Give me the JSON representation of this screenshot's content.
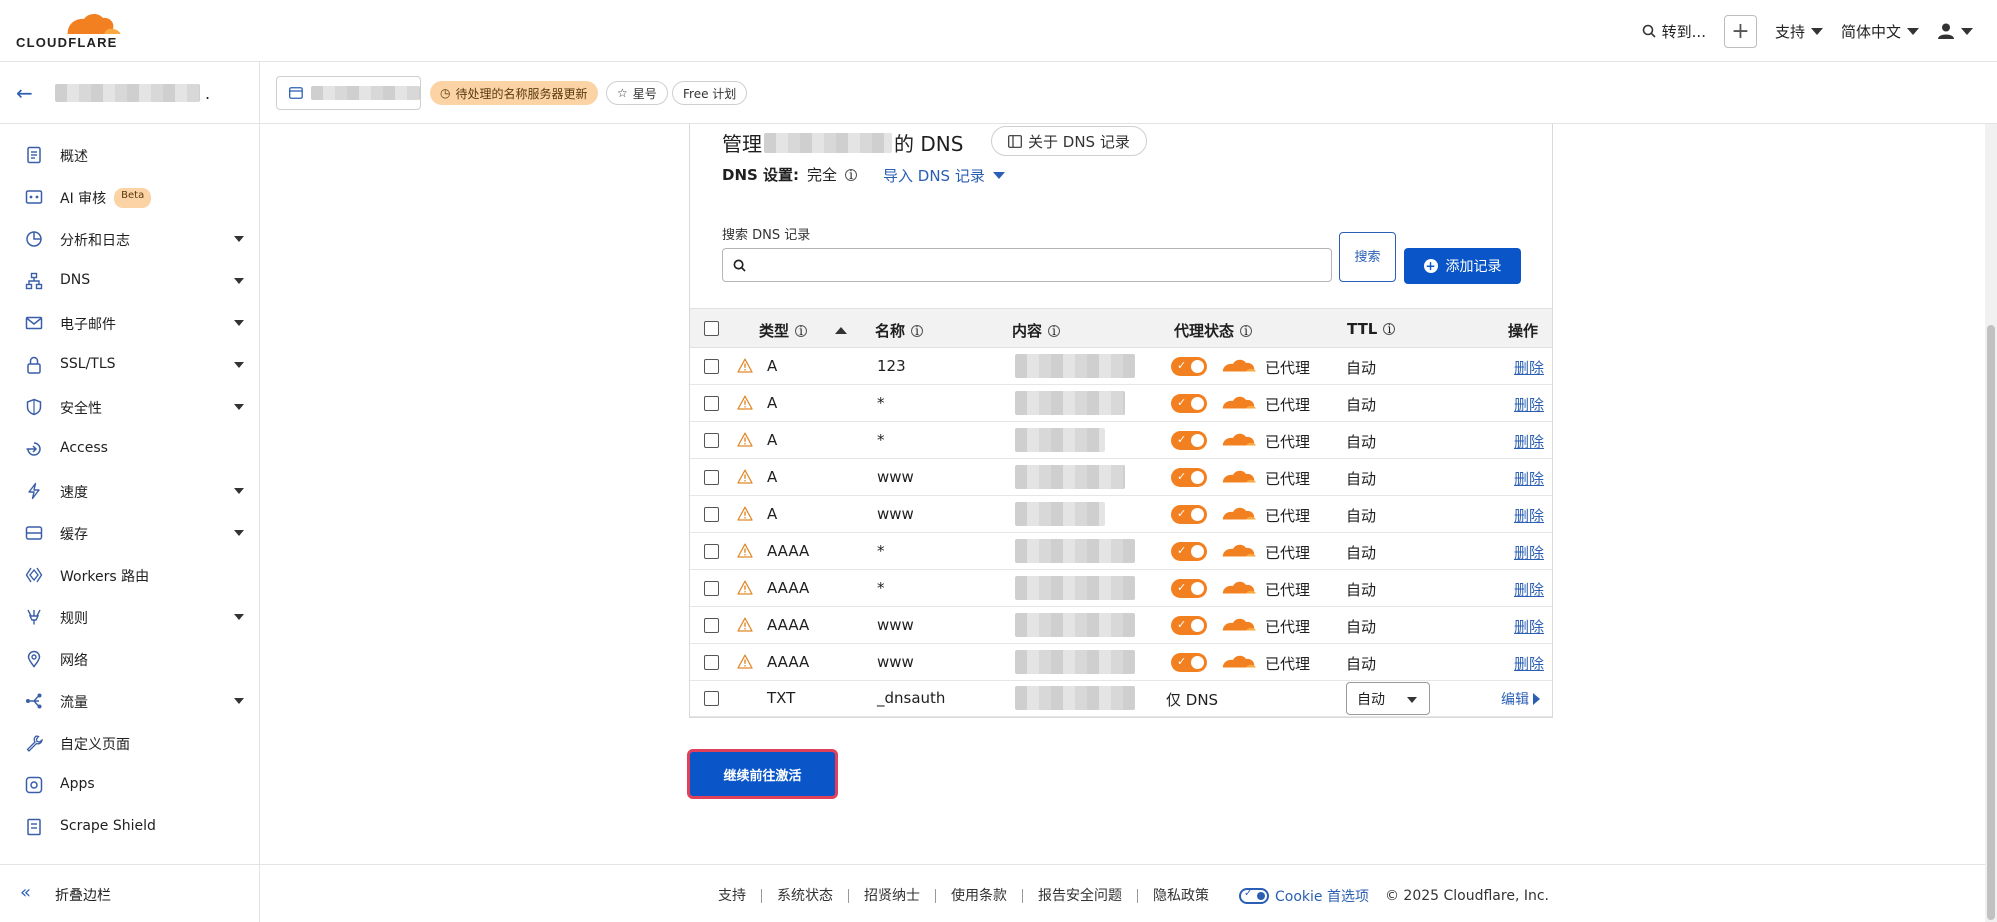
{
  "topbar": {
    "brand": "CLOUDFLARE",
    "goto": "转到...",
    "support": "支持",
    "language": "简体中文"
  },
  "subheader": {
    "zone_dot": ".",
    "badges": {
      "pending": "待处理的名称服务器更新",
      "star": "星号",
      "plan": "Free 计划"
    }
  },
  "sidebar": {
    "items": [
      {
        "label": "概述",
        "icon": "document-icon",
        "has_caret": false
      },
      {
        "label": "AI 审核",
        "icon": "ai-audit-icon",
        "has_caret": false,
        "badge": "Beta"
      },
      {
        "label": "分析和日志",
        "icon": "chart-icon",
        "has_caret": true
      },
      {
        "label": "DNS",
        "icon": "network-icon",
        "has_caret": true
      },
      {
        "label": "电子邮件",
        "icon": "email-icon",
        "has_caret": true
      },
      {
        "label": "SSL/TLS",
        "icon": "lock-icon",
        "has_caret": true
      },
      {
        "label": "安全性",
        "icon": "shield-icon",
        "has_caret": true
      },
      {
        "label": "Access",
        "icon": "access-icon",
        "has_caret": false
      },
      {
        "label": "速度",
        "icon": "lightning-icon",
        "has_caret": true
      },
      {
        "label": "缓存",
        "icon": "storage-icon",
        "has_caret": true
      },
      {
        "label": "Workers 路由",
        "icon": "workers-icon",
        "has_caret": false
      },
      {
        "label": "规则",
        "icon": "rules-icon",
        "has_caret": true
      },
      {
        "label": "网络",
        "icon": "location-icon",
        "has_caret": false
      },
      {
        "label": "流量",
        "icon": "traffic-icon",
        "has_caret": true
      },
      {
        "label": "自定义页面",
        "icon": "wrench-icon",
        "has_caret": false
      },
      {
        "label": "Apps",
        "icon": "apps-icon",
        "has_caret": false
      },
      {
        "label": "Scrape Shield",
        "icon": "scrape-shield-icon",
        "has_caret": false
      }
    ],
    "collapse_label": "折叠边栏"
  },
  "dns": {
    "title_prefix": "管理",
    "title_suffix": "的 DNS",
    "about_label": "关于 DNS 记录",
    "settings_label": "DNS 设置:",
    "settings_value": "完全",
    "import_label": "导入 DNS 记录",
    "search_label": "搜索 DNS 记录",
    "search_placeholder": "",
    "search_button": "搜索",
    "add_button": "添加记录",
    "columns": {
      "type": "类型",
      "name": "名称",
      "content": "内容",
      "proxy": "代理状态",
      "ttl": "TTL",
      "actions": "操作"
    },
    "records": [
      {
        "type": "A",
        "name": "123",
        "proxy": "已代理",
        "ttl": "自动",
        "action": "删除"
      },
      {
        "type": "A",
        "name": "*",
        "proxy": "已代理",
        "ttl": "自动",
        "action": "删除"
      },
      {
        "type": "A",
        "name": "*",
        "proxy": "已代理",
        "ttl": "自动",
        "action": "删除"
      },
      {
        "type": "A",
        "name": "www",
        "proxy": "已代理",
        "ttl": "自动",
        "action": "删除"
      },
      {
        "type": "A",
        "name": "www",
        "proxy": "已代理",
        "ttl": "自动",
        "action": "删除"
      },
      {
        "type": "AAAA",
        "name": "*",
        "proxy": "已代理",
        "ttl": "自动",
        "action": "删除"
      },
      {
        "type": "AAAA",
        "name": "*",
        "proxy": "已代理",
        "ttl": "自动",
        "action": "删除"
      },
      {
        "type": "AAAA",
        "name": "www",
        "proxy": "已代理",
        "ttl": "自动",
        "action": "删除"
      },
      {
        "type": "AAAA",
        "name": "www",
        "proxy": "已代理",
        "ttl": "自动",
        "action": "删除"
      }
    ],
    "txt_record": {
      "type": "TXT",
      "name": "_dnsauth",
      "proxy": "仅 DNS",
      "ttl": "自动",
      "action": "编辑"
    },
    "continue_button": "继续前往激活"
  },
  "footer": {
    "links": [
      "支持",
      "系统状态",
      "招贤纳士",
      "使用条款",
      "报告安全问题",
      "隐私政策"
    ],
    "cookie_label": "Cookie 首选项",
    "copyright": "© 2025 Cloudflare, Inc."
  },
  "colors": {
    "accent_blue": "#0a56c9",
    "link_blue": "#2b5fb4",
    "cloudflare_orange": "#f38020",
    "pending_badge": "#fbd3a5"
  }
}
